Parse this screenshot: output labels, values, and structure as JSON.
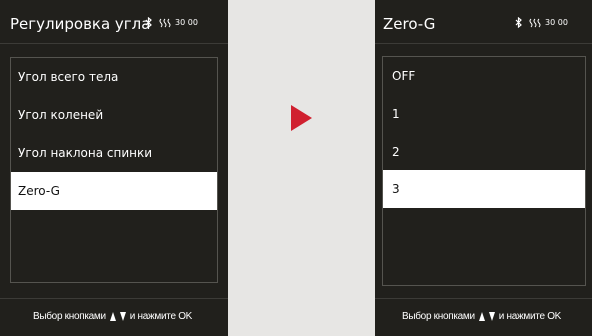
{
  "left_screen": {
    "title": "Регулировка угла",
    "status_time": "30 00",
    "icons": [
      "bluetooth-icon",
      "signal-icon"
    ],
    "menu_items": [
      {
        "label": "Угол всего тела",
        "selected": false
      },
      {
        "label": "Угол коленей",
        "selected": false
      },
      {
        "label": "Угол наклона спинки",
        "selected": false
      },
      {
        "label": "Zero-G",
        "selected": true
      }
    ],
    "footer": {
      "before": "Выбор кнопками",
      "after": "и нажмите OK"
    }
  },
  "right_screen": {
    "title": "Zero-G",
    "status_time": "30 00",
    "icons": [
      "bluetooth-icon",
      "signal-icon"
    ],
    "menu_items": [
      {
        "label": "OFF",
        "selected": false
      },
      {
        "label": "1",
        "selected": false
      },
      {
        "label": "2",
        "selected": false
      },
      {
        "label": "3",
        "selected": true
      }
    ],
    "footer": {
      "before": "Выбор кнопками",
      "after": "и нажмите OK"
    }
  },
  "colors": {
    "screen_bg": "#21201c",
    "selected_bg": "#ffffff",
    "arrow": "#d0202f",
    "page_bg": "#e7e6e4"
  }
}
